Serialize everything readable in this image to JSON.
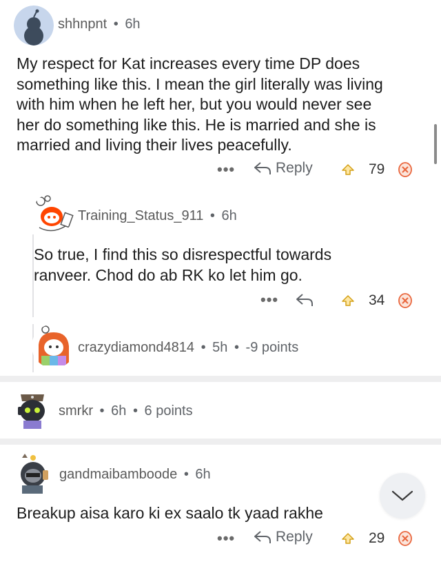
{
  "comments": [
    {
      "username": "shhnpnt",
      "age": "6h",
      "body_lines": [
        "My respect for Kat increases every time DP does",
        "something like this. I mean the girl literally was living",
        "with him when he left her, but you would never see",
        "her do something like this. He is married and she is",
        "married and living their lives peacefully."
      ],
      "reply_label": "Reply",
      "votes": "79"
    },
    {
      "username": "Training_Status_911",
      "age": "6h",
      "body_lines": [
        "So true, I find this so disrespectful towards",
        "ranveer. Chod do ab RK ko let him go."
      ],
      "votes": "34"
    },
    {
      "username": "crazydiamond4814",
      "age": "5h",
      "points": "-9 points"
    },
    {
      "username": "smrkr",
      "age": "6h",
      "points": "6 points"
    },
    {
      "username": "gandmaibamboode",
      "age": "6h",
      "body_lines": [
        "Breakup aisa karo ki ex saalo tk yaad rakhe"
      ],
      "reply_label": "Reply",
      "votes": "29"
    }
  ],
  "separator": "•",
  "more_dots": "•••",
  "colors": {
    "upvote": "#d4a017",
    "downvote": "#e9653c",
    "separator": "#eeeeef"
  },
  "icons": [
    "more-icon",
    "reply-arrow-icon",
    "upvote-icon",
    "downvote-icon",
    "chevron-down-icon"
  ]
}
